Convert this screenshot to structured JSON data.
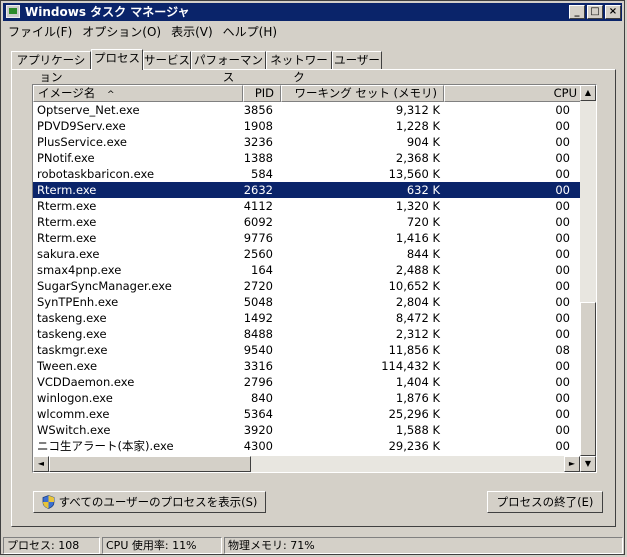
{
  "window": {
    "title": "Windows タスク マネージャ",
    "buttons": {
      "minimize": "_",
      "maximize": "□",
      "close": "×"
    }
  },
  "menubar": [
    "ファイル(F)",
    "オプション(O)",
    "表示(V)",
    "ヘルプ(H)"
  ],
  "tabs": [
    "アプリケーション",
    "プロセス",
    "サービス",
    "パフォーマンス",
    "ネットワーク",
    "ユーザー"
  ],
  "active_tab": "プロセス",
  "table": {
    "columns": [
      "イメージ名",
      "PID",
      "ワーキング セット (メモリ)",
      "CPU"
    ],
    "sort_indicator": "^",
    "selected_index": 5,
    "rows": [
      {
        "name": "Optserve_Net.exe",
        "pid": "3856",
        "mem": "9,312 K",
        "cpu": "00"
      },
      {
        "name": "PDVD9Serv.exe",
        "pid": "1908",
        "mem": "1,228 K",
        "cpu": "00"
      },
      {
        "name": "PlusService.exe",
        "pid": "3236",
        "mem": "904 K",
        "cpu": "00"
      },
      {
        "name": "PNotif.exe",
        "pid": "1388",
        "mem": "2,368 K",
        "cpu": "00"
      },
      {
        "name": "robotaskbaricon.exe",
        "pid": "584",
        "mem": "13,560 K",
        "cpu": "00"
      },
      {
        "name": "Rterm.exe",
        "pid": "2632",
        "mem": "632 K",
        "cpu": "00"
      },
      {
        "name": "Rterm.exe",
        "pid": "4112",
        "mem": "1,320 K",
        "cpu": "00"
      },
      {
        "name": "Rterm.exe",
        "pid": "6092",
        "mem": "720 K",
        "cpu": "00"
      },
      {
        "name": "Rterm.exe",
        "pid": "9776",
        "mem": "1,416 K",
        "cpu": "00"
      },
      {
        "name": "sakura.exe",
        "pid": "2560",
        "mem": "844 K",
        "cpu": "00"
      },
      {
        "name": "smax4pnp.exe",
        "pid": "164",
        "mem": "2,488 K",
        "cpu": "00"
      },
      {
        "name": "SugarSyncManager.exe",
        "pid": "2720",
        "mem": "10,652 K",
        "cpu": "00"
      },
      {
        "name": "SynTPEnh.exe",
        "pid": "5048",
        "mem": "2,804 K",
        "cpu": "00"
      },
      {
        "name": "taskeng.exe",
        "pid": "1492",
        "mem": "8,472 K",
        "cpu": "00"
      },
      {
        "name": "taskeng.exe",
        "pid": "8488",
        "mem": "2,312 K",
        "cpu": "00"
      },
      {
        "name": "taskmgr.exe",
        "pid": "9540",
        "mem": "11,856 K",
        "cpu": "08"
      },
      {
        "name": "Tween.exe",
        "pid": "3316",
        "mem": "114,432 K",
        "cpu": "00"
      },
      {
        "name": "VCDDaemon.exe",
        "pid": "2796",
        "mem": "1,404 K",
        "cpu": "00"
      },
      {
        "name": "winlogon.exe",
        "pid": "840",
        "mem": "1,876 K",
        "cpu": "00"
      },
      {
        "name": "wlcomm.exe",
        "pid": "5364",
        "mem": "25,296 K",
        "cpu": "00"
      },
      {
        "name": "WSwitch.exe",
        "pid": "3920",
        "mem": "1,588 K",
        "cpu": "00"
      },
      {
        "name": "ニコ生アラート(本家).exe",
        "pid": "4300",
        "mem": "29,236 K",
        "cpu": "00"
      }
    ]
  },
  "scroll_arrows": {
    "up": "▲",
    "down": "▼",
    "left": "◄",
    "right": "►"
  },
  "buttons": {
    "show_all": "すべてのユーザーのプロセスを表示(S)",
    "end_process": "プロセスの終了(E)"
  },
  "statusbar": {
    "processes": "プロセス: 108",
    "cpu": "CPU 使用率: 11%",
    "memory": "物理メモリ: 71%"
  }
}
